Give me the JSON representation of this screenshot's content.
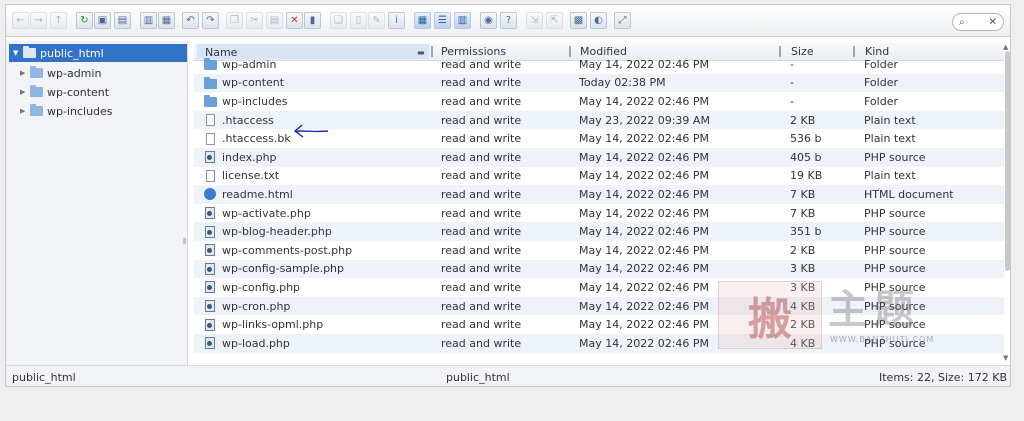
{
  "toolbar": {
    "buttons": [
      {
        "icon": "back-arrow-icon"
      },
      {
        "icon": "forward-arrow-icon"
      },
      {
        "icon": "up-arrow-icon"
      },
      {
        "icon": "reload-icon"
      },
      {
        "icon": "new-folder-icon"
      },
      {
        "icon": "new-file-icon"
      },
      {
        "icon": "open-icon"
      },
      {
        "icon": "save-icon"
      },
      {
        "icon": "undo-icon"
      },
      {
        "icon": "redo-icon"
      },
      {
        "icon": "copy-icon"
      },
      {
        "icon": "cut-icon"
      },
      {
        "icon": "paste-icon"
      },
      {
        "icon": "delete-icon"
      },
      {
        "icon": "empty-icon"
      },
      {
        "icon": "duplicate-icon"
      },
      {
        "icon": "rename-icon"
      },
      {
        "icon": "edit-icon"
      },
      {
        "icon": "info-icon"
      },
      {
        "icon": "icons-view-icon"
      },
      {
        "icon": "list-view-icon"
      },
      {
        "icon": "columns-view-icon"
      },
      {
        "icon": "preview-icon"
      },
      {
        "icon": "help-icon"
      },
      {
        "icon": "extract-icon"
      },
      {
        "icon": "archive-icon"
      },
      {
        "icon": "select-all-icon"
      },
      {
        "icon": "invert-selection-icon"
      },
      {
        "icon": "fullscreen-icon"
      }
    ],
    "search_glyph": "⌕",
    "search_clear": "✕"
  },
  "tree": {
    "root": "public_html",
    "children": [
      "wp-admin",
      "wp-content",
      "wp-includes"
    ]
  },
  "columns": {
    "name": "Name",
    "permissions": "Permissions",
    "modified": "Modified",
    "size": "Size",
    "kind": "Kind"
  },
  "files": [
    {
      "type": "folder",
      "name": "wp-admin",
      "permissions": "read and write",
      "modified": "May 14, 2022 02:46 PM",
      "size": "-",
      "kind": "Folder"
    },
    {
      "type": "folder",
      "name": "wp-content",
      "permissions": "read and write",
      "modified": "Today 02:38 PM",
      "size": "-",
      "kind": "Folder"
    },
    {
      "type": "folder",
      "name": "wp-includes",
      "permissions": "read and write",
      "modified": "May 14, 2022 02:46 PM",
      "size": "-",
      "kind": "Folder"
    },
    {
      "type": "text",
      "name": ".htaccess",
      "permissions": "read and write",
      "modified": "May 23, 2022 09:39 AM",
      "size": "2 KB",
      "kind": "Plain text"
    },
    {
      "type": "text",
      "name": ".htaccess.bk",
      "permissions": "read and write",
      "modified": "May 14, 2022 02:46 PM",
      "size": "536 b",
      "kind": "Plain text"
    },
    {
      "type": "php",
      "name": "index.php",
      "permissions": "read and write",
      "modified": "May 14, 2022 02:46 PM",
      "size": "405 b",
      "kind": "PHP source"
    },
    {
      "type": "text",
      "name": "license.txt",
      "permissions": "read and write",
      "modified": "May 14, 2022 02:46 PM",
      "size": "19 KB",
      "kind": "Plain text"
    },
    {
      "type": "html",
      "name": "readme.html",
      "permissions": "read and write",
      "modified": "May 14, 2022 02:46 PM",
      "size": "7 KB",
      "kind": "HTML document"
    },
    {
      "type": "php",
      "name": "wp-activate.php",
      "permissions": "read and write",
      "modified": "May 14, 2022 02:46 PM",
      "size": "7 KB",
      "kind": "PHP source"
    },
    {
      "type": "php",
      "name": "wp-blog-header.php",
      "permissions": "read and write",
      "modified": "May 14, 2022 02:46 PM",
      "size": "351 b",
      "kind": "PHP source"
    },
    {
      "type": "php",
      "name": "wp-comments-post.php",
      "permissions": "read and write",
      "modified": "May 14, 2022 02:46 PM",
      "size": "2 KB",
      "kind": "PHP source"
    },
    {
      "type": "php",
      "name": "wp-config-sample.php",
      "permissions": "read and write",
      "modified": "May 14, 2022 02:46 PM",
      "size": "3 KB",
      "kind": "PHP source"
    },
    {
      "type": "php",
      "name": "wp-config.php",
      "permissions": "read and write",
      "modified": "May 14, 2022 02:46 PM",
      "size": "3 KB",
      "kind": "PHP source"
    },
    {
      "type": "php",
      "name": "wp-cron.php",
      "permissions": "read and write",
      "modified": "May 14, 2022 02:46 PM",
      "size": "4 KB",
      "kind": "PHP source"
    },
    {
      "type": "php",
      "name": "wp-links-opml.php",
      "permissions": "read and write",
      "modified": "May 14, 2022 02:46 PM",
      "size": "2 KB",
      "kind": "PHP source"
    },
    {
      "type": "php",
      "name": "wp-load.php",
      "permissions": "read and write",
      "modified": "May 14, 2022 02:46 PM",
      "size": "4 KB",
      "kind": "PHP source"
    }
  ],
  "status": {
    "left": "public_html",
    "center": "public_html",
    "right": "Items: 22, Size: 172 KB"
  },
  "watermark": {
    "stamp": "搬",
    "text": "主题",
    "url": "WWW.BANZHUTI.COM"
  },
  "colors": {
    "selection": "#3273c8",
    "row_alt": "#eef3fa",
    "annotation_arrow": "#1a2fb0"
  }
}
